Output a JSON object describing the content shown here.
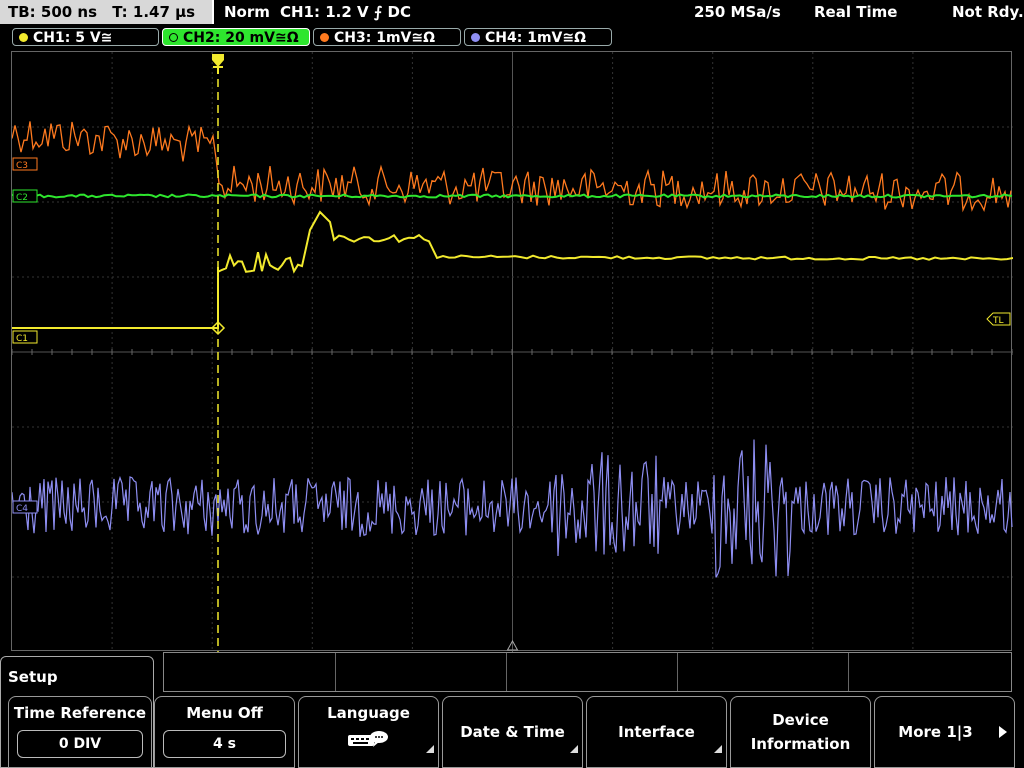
{
  "header": {
    "timebase": "TB: 500 ns",
    "trigger_time": "T: 1.47 µs",
    "trigger_mode": "Norm",
    "trigger_info": "CH1: 1.2 V ⨍ DC",
    "sample_rate": "250 MSa/s",
    "acq_mode": "Real Time",
    "status": "Not Rdy."
  },
  "channels": [
    {
      "label": "CH1: 5 V≅",
      "color": "#f2ea2e",
      "marker": "C1"
    },
    {
      "label": "CH2: 20 mV≅Ω",
      "color": "#2ee62e",
      "marker": "C2"
    },
    {
      "label": "CH3: 1mV≅Ω",
      "color": "#ff7a1f",
      "marker": "C3"
    },
    {
      "label": "CH4: 1mV≅Ω",
      "color": "#8e8ef2",
      "marker": "C4"
    }
  ],
  "trigger_level_marker": "TL",
  "setup": {
    "title": "Setup"
  },
  "softkeys": [
    {
      "label": "Time Reference",
      "value": "0 DIV"
    },
    {
      "label": "Menu Off",
      "value": "4 s"
    },
    {
      "label": "Language"
    },
    {
      "label": "Date & Time"
    },
    {
      "label": "Interface"
    },
    {
      "label_line1": "Device",
      "label_line2": "Information"
    },
    {
      "label": "More 1|3"
    }
  ],
  "icons": [
    "keyboard-speech-icon",
    "play-arrow-icon",
    "trigger-position-icon",
    "menu-triangle-icon"
  ]
}
